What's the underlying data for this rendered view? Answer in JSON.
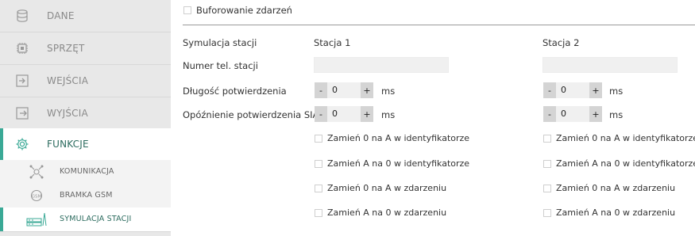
{
  "sidebar": {
    "items": [
      {
        "label": "DANE",
        "icon": "database-icon"
      },
      {
        "label": "SPRZĘT",
        "icon": "chip-icon"
      },
      {
        "label": "WEJŚCIA",
        "icon": "input-icon"
      },
      {
        "label": "WYJŚCIA",
        "icon": "output-icon"
      },
      {
        "label": "FUNKCJE",
        "icon": "gear-icon"
      }
    ],
    "subitems": [
      {
        "label": "KOMUNIKACJA",
        "icon": "communication-icon"
      },
      {
        "label": "BRAMKA GSM",
        "icon": "gsm-gateway-icon"
      },
      {
        "label": "SYMULACJA STACJI",
        "icon": "station-simulation-icon"
      }
    ],
    "accent_color": "#3aa996"
  },
  "main": {
    "event_buffering": {
      "label": "Buforowanie zdarzeń",
      "checked": false
    },
    "labels": {
      "station_simulation": "Symulacja stacji",
      "phone_number": "Numer tel. stacji",
      "ack_length": "Długość potwierdzenia",
      "sia_ack_delay": "Opóźnienie potwierdzenia SIA"
    },
    "stations": [
      {
        "title": "Stacja 1",
        "phone": "",
        "ack_length": {
          "minus": "-",
          "value": "0",
          "plus": "+",
          "unit": "ms"
        },
        "sia_delay": {
          "minus": "-",
          "value": "0",
          "plus": "+",
          "unit": "ms"
        },
        "options": [
          {
            "label": "Zamień 0 na A w identyfikatorze",
            "checked": false
          },
          {
            "label": "Zamień A na 0 w identyfikatorze",
            "checked": false
          },
          {
            "label": "Zamień 0 na A w zdarzeniu",
            "checked": false
          },
          {
            "label": "Zamień A na 0 w zdarzeniu",
            "checked": false
          }
        ]
      },
      {
        "title": "Stacja 2",
        "phone": "",
        "ack_length": {
          "minus": "-",
          "value": "0",
          "plus": "+",
          "unit": "ms"
        },
        "sia_delay": {
          "minus": "-",
          "value": "0",
          "plus": "+",
          "unit": "ms"
        },
        "options": [
          {
            "label": "Zamień 0 na A w identyfikatorze",
            "checked": false
          },
          {
            "label": "Zamień A na 0 w identyfikatorze",
            "checked": false
          },
          {
            "label": "Zamień 0 na A w zdarzeniu",
            "checked": false
          },
          {
            "label": "Zamień A na 0 w zdarzeniu",
            "checked": false
          }
        ]
      }
    ]
  }
}
